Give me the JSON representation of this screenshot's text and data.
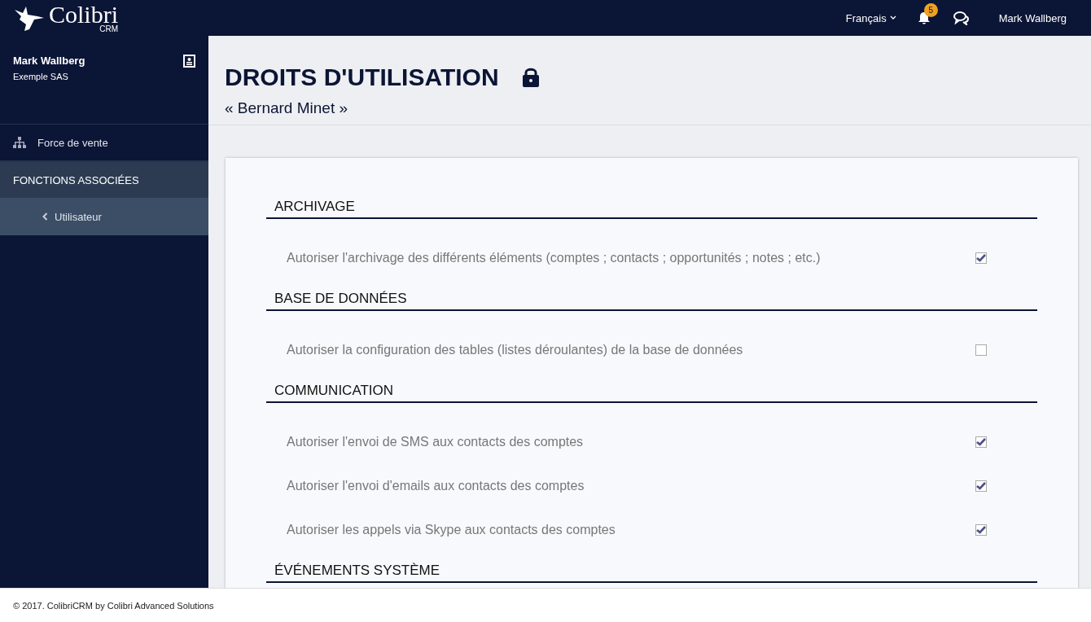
{
  "topbar": {
    "logo": "Colibri",
    "logo_sub": "CRM",
    "language": "Français",
    "notifications": "5",
    "user": "Mark Wallberg"
  },
  "sidebar": {
    "user_name": "Mark Wallberg",
    "company": "Exemple SAS",
    "items": [
      {
        "kind": "link",
        "label": "Force de vente"
      },
      {
        "kind": "header",
        "label": "FONCTIONS ASSOCIÉES"
      },
      {
        "kind": "back",
        "label": "Utilisateur",
        "selected": true
      }
    ]
  },
  "page": {
    "title": "DROITS D'UTILISATION",
    "subtitle": "« Bernard Minet »"
  },
  "sections": [
    {
      "title": "ARCHIVAGE",
      "rows": [
        {
          "label": "Autoriser l'archivage des différents éléments (comptes ; contacts ; opportunités ; notes ; etc.)",
          "checked": true
        }
      ]
    },
    {
      "title": "BASE DE DONNÉES",
      "rows": [
        {
          "label": "Autoriser la configuration des tables (listes déroulantes) de la base de données",
          "checked": false
        }
      ]
    },
    {
      "title": "COMMUNICATION",
      "rows": [
        {
          "label": "Autoriser l'envoi de SMS aux contacts des comptes",
          "checked": true
        },
        {
          "label": "Autoriser l'envoi d'emails aux contacts des comptes",
          "checked": true
        },
        {
          "label": "Autoriser les appels via Skype aux contacts des comptes",
          "checked": true
        }
      ]
    },
    {
      "title": "ÉVÉNEMENTS SYSTÈME"
    }
  ],
  "footer": "© 2017. ColibriCRM by Colibri Advanced Solutions"
}
